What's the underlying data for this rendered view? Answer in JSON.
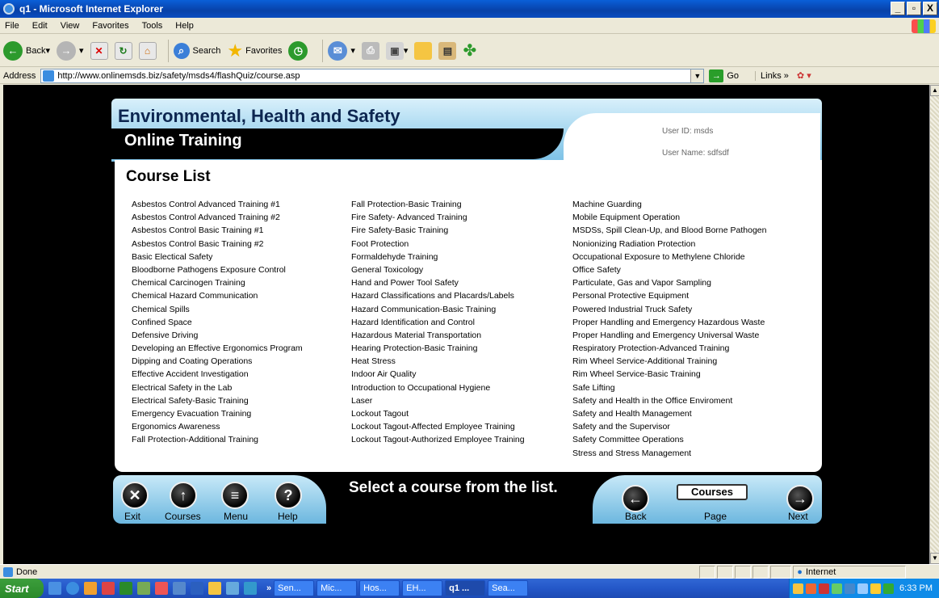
{
  "window": {
    "title": "q1 - Microsoft Internet Explorer",
    "buttons": [
      "_",
      "▫",
      "X"
    ]
  },
  "menu": [
    "File",
    "Edit",
    "View",
    "Favorites",
    "Tools",
    "Help"
  ],
  "toolbar": {
    "back": "Back",
    "search": "Search",
    "favorites": "Favorites"
  },
  "address": {
    "label": "Address",
    "url": "http://www.onlinemsds.biz/safety/msds4/flashQuiz/course.asp",
    "go": "Go",
    "links": "Links"
  },
  "page": {
    "header_title": "Environmental, Health and Safety",
    "header_subtitle": "Online Training",
    "user_id": "User ID: msds",
    "user_name": "User Name: sdfsdf",
    "section_title": "Course List",
    "columns": [
      [
        "Asbestos Control Advanced Training #1",
        "Asbestos Control Advanced Training #2",
        "Asbestos Control Basic Training #1",
        "Asbestos Control Basic Training #2",
        "Basic Electical Safety",
        "Bloodborne Pathogens Exposure Control",
        "Chemical Carcinogen Training",
        "Chemical Hazard Communication",
        "Chemical Spills",
        "Confined Space",
        "Defensive Driving",
        "Developing an Effective Ergonomics Program",
        "Dipping and Coating Operations",
        "Effective Accident Investigation",
        "Electrical Safety in the Lab",
        "Electrical Safety-Basic Training",
        "Emergency Evacuation Training",
        "Ergonomics Awareness",
        "Fall Protection-Additional Training"
      ],
      [
        "Fall Protection-Basic Training",
        "Fire Safety- Advanced Training",
        "Fire Safety-Basic Training",
        "Foot Protection",
        "Formaldehyde Training",
        "General Toxicology",
        "Hand and Power Tool Safety",
        "Hazard Classifications and Placards/Labels",
        "Hazard Communication-Basic Training",
        "Hazard Identification and Control",
        "Hazardous Material Transportation",
        "Hearing Protection-Basic Training",
        "Heat Stress",
        "Indoor Air Quality",
        "Introduction to Occupational Hygiene",
        "Laser",
        "Lockout Tagout",
        "Lockout Tagout-Affected Employee Training",
        "Lockout Tagout-Authorized Employee Training"
      ],
      [
        "Machine Guarding",
        "Mobile Equipment Operation",
        "MSDSs, Spill Clean-Up, and Blood Borne Pathogen",
        "Nonionizing Radiation Protection",
        "Occupational Exposure to Methylene Chloride",
        "Office Safety",
        "Particulate, Gas and Vapor Sampling",
        "Personal Protective Equipment",
        "Powered Industrial Truck Safety",
        "Proper Handling and Emergency  Hazardous Waste",
        "Proper Handling and Emergency  Universal Waste",
        "Respiratory Protection-Advanced Training",
        "Rim Wheel Service-Additional Training",
        "Rim Wheel Service-Basic Training",
        "Safe Lifting",
        "Safety and Health in the Office Enviroment",
        "Safety and Health Management",
        "Safety and the Supervisor",
        "Safety Committee Operations",
        "Stress and Stress Management"
      ]
    ],
    "nav": {
      "exit": "Exit",
      "courses": "Courses",
      "menu": "Menu",
      "help": "Help",
      "prompt": "Select a course from the list.",
      "back": "Back",
      "page": "Page",
      "next": "Next",
      "courses_box": "Courses"
    }
  },
  "status": {
    "text": "Done",
    "zone": "Internet"
  },
  "taskbar": {
    "start": "Start",
    "tasks": [
      "Sen...",
      "Mic...",
      "Hos...",
      "EH...",
      "q1 ...",
      "Sea..."
    ],
    "active_index": 4,
    "clock": "6:33 PM"
  }
}
